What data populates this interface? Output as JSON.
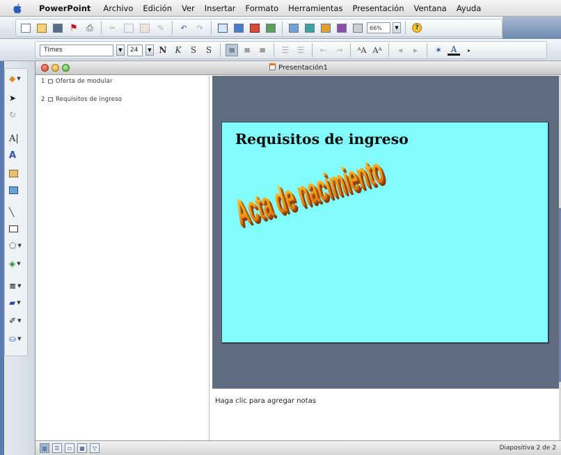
{
  "menubar": {
    "app": "PowerPoint",
    "items": [
      "Archivo",
      "Edición",
      "Ver",
      "Insertar",
      "Formato",
      "Herramientas",
      "Presentación",
      "Ventana",
      "Ayuda"
    ]
  },
  "toolbar": {
    "zoom": "66%"
  },
  "format_toolbar": {
    "font": "Times",
    "size": "24",
    "bold_label": "N",
    "italic_label": "K",
    "underline_label": "S",
    "shadow_label": "S"
  },
  "window": {
    "title": "Presentación1"
  },
  "outline": {
    "slides": [
      {
        "num": "1",
        "title": "Oferta de modular"
      },
      {
        "num": "2",
        "title": "Requisitos de ingreso"
      }
    ]
  },
  "slide": {
    "title": "Requisitos de ingreso",
    "wordart": "Acta de nacimiento",
    "background": "#82fbfb"
  },
  "notes": {
    "placeholder": "Haga clic para agregar notas"
  },
  "status": {
    "text": "Diapositiva 2 de 2"
  }
}
